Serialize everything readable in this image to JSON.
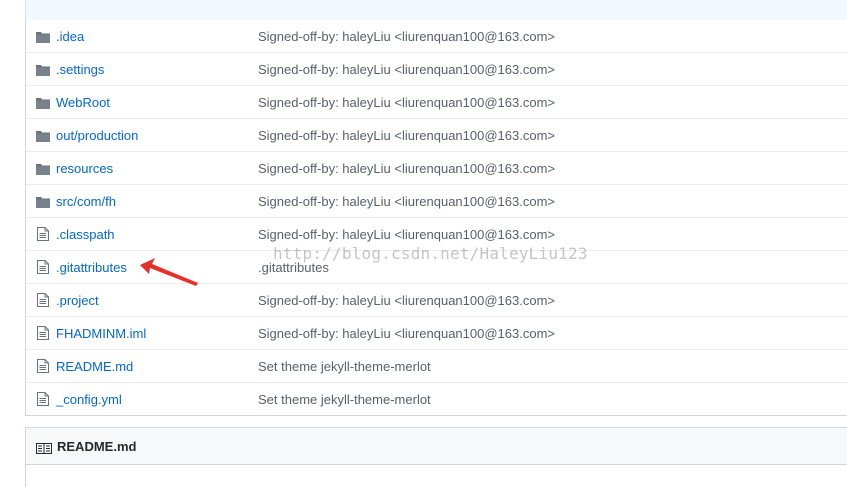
{
  "files": [
    {
      "type": "folder",
      "icon": "folder-icon",
      "name": ".idea",
      "message": "Signed-off-by: haleyLiu <liurenquan100@163.com>"
    },
    {
      "type": "folder",
      "icon": "folder-icon",
      "name": ".settings",
      "message": "Signed-off-by: haleyLiu <liurenquan100@163.com>"
    },
    {
      "type": "folder",
      "icon": "folder-icon",
      "name": "WebRoot",
      "message": "Signed-off-by: haleyLiu <liurenquan100@163.com>"
    },
    {
      "type": "folder",
      "icon": "folder-icon",
      "name": "out/production",
      "message": "Signed-off-by: haleyLiu <liurenquan100@163.com>"
    },
    {
      "type": "folder",
      "icon": "folder-icon",
      "name": "resources",
      "message": "Signed-off-by: haleyLiu <liurenquan100@163.com>"
    },
    {
      "type": "folder",
      "icon": "folder-icon",
      "name": "src/com/fh",
      "message": "Signed-off-by: haleyLiu <liurenquan100@163.com>"
    },
    {
      "type": "file",
      "icon": "file-icon",
      "name": ".classpath",
      "message": "Signed-off-by: haleyLiu <liurenquan100@163.com>"
    },
    {
      "type": "file",
      "icon": "file-icon",
      "name": ".gitattributes",
      "message": ".gitattributes"
    },
    {
      "type": "file",
      "icon": "file-icon",
      "name": ".project",
      "message": "Signed-off-by: haleyLiu <liurenquan100@163.com>"
    },
    {
      "type": "file",
      "icon": "file-icon",
      "name": "FHADMINM.iml",
      "message": "Signed-off-by: haleyLiu <liurenquan100@163.com>"
    },
    {
      "type": "file",
      "icon": "file-icon",
      "name": "README.md",
      "message": "Set theme jekyll-theme-merlot"
    },
    {
      "type": "file",
      "icon": "file-icon",
      "name": "_config.yml",
      "message": "Set theme jekyll-theme-merlot"
    }
  ],
  "readme": {
    "icon": "book-icon",
    "title": "README.md"
  },
  "watermark": "http://blog.csdn.net/HaleyLiu123",
  "annotation": {
    "icon": "red-arrow-icon",
    "color": "#e8302a"
  },
  "colors": {
    "link": "#0366d6",
    "message": "#586069",
    "icon": "#6a737d",
    "border": "#d1d5da",
    "row_border": "#eaecef"
  }
}
